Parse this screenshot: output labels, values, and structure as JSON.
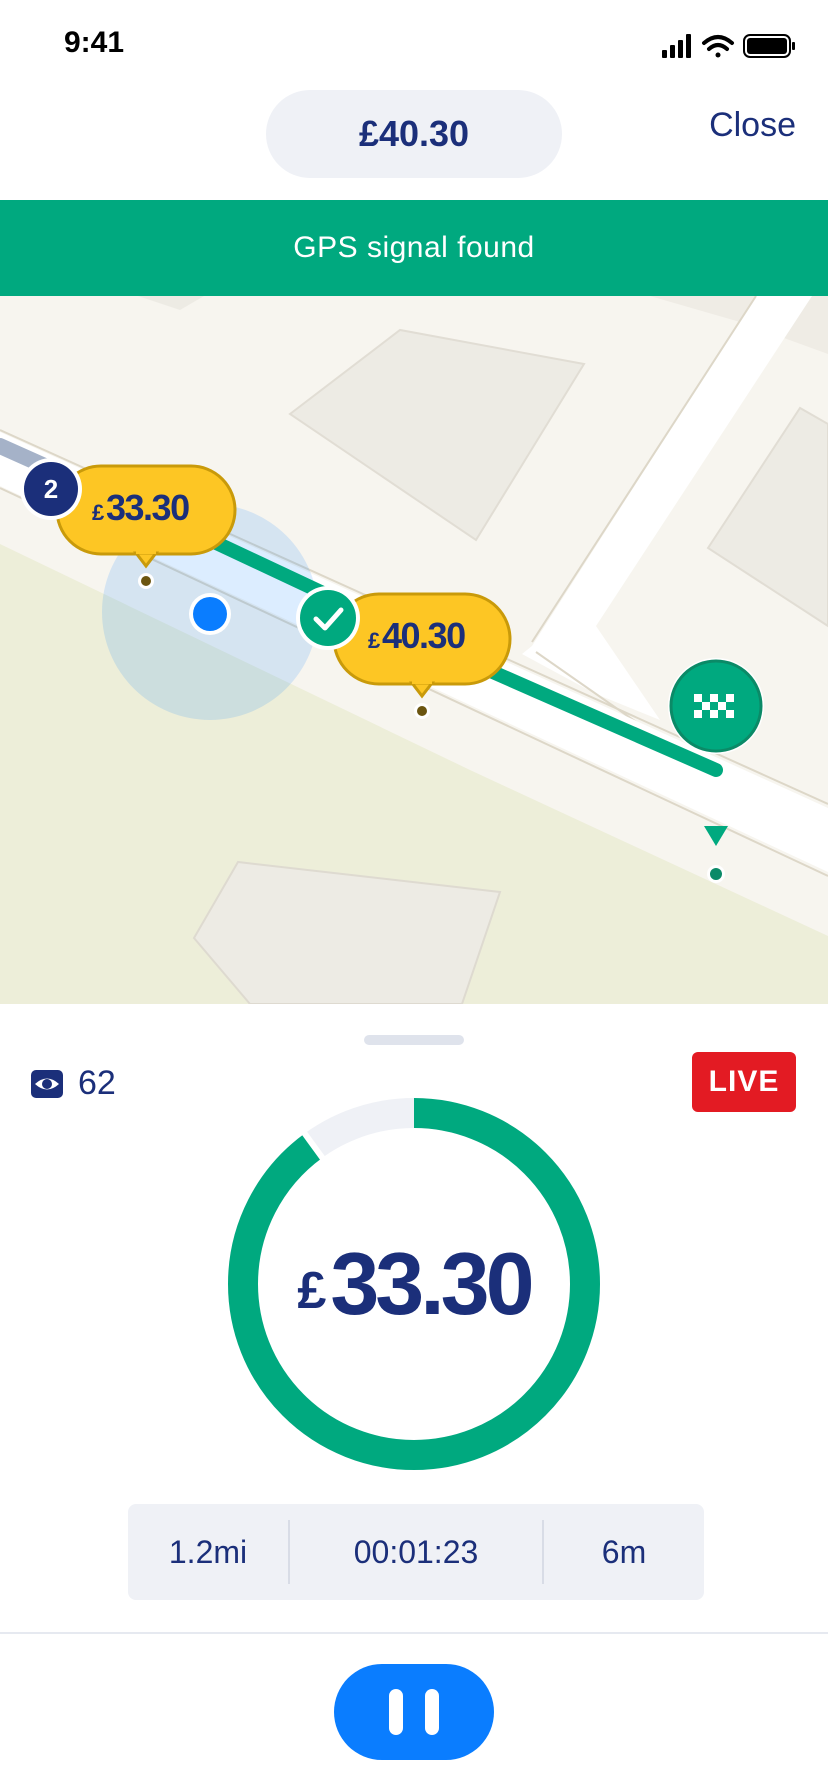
{
  "status_bar": {
    "time": "9:41",
    "icons": [
      "signal-icon",
      "wifi-icon",
      "battery-icon"
    ]
  },
  "header": {
    "fare": "£40.30",
    "close_label": "Close"
  },
  "banner": {
    "text": "GPS signal found",
    "color": "#00a97f"
  },
  "map": {
    "bubble_bid": {
      "rank": "2",
      "currency": "£",
      "amount": "33.30"
    },
    "bubble_confirmed": {
      "currency": "£",
      "amount": "40.30"
    },
    "destination_icon": "chequered-flag-icon",
    "route_color": "#00a97f",
    "current_location_color": "#0a7dff"
  },
  "meter": {
    "viewers": "62",
    "live_label": "LIVE",
    "currency": "£",
    "amount": "33.30",
    "progress": 0.9,
    "stats": {
      "distance": "1.2mi",
      "elapsed": "00:01:23",
      "remaining": "6m"
    }
  },
  "controls": {
    "pause_icon": "pause-icon"
  },
  "colors": {
    "brand_navy": "#1b2f7a",
    "accent_green": "#00a97f",
    "bubble_yellow": "#fdc624",
    "live_red": "#e31b23",
    "action_blue": "#0a7dff"
  }
}
